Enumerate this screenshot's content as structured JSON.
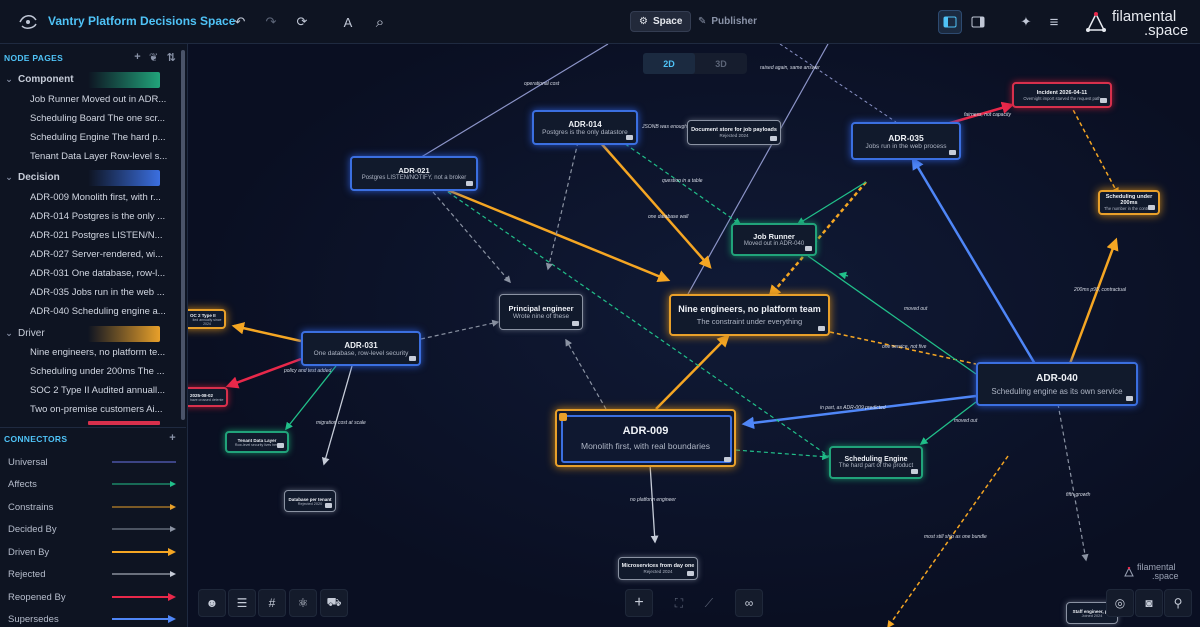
{
  "app": {
    "title": "Vantry Platform Decisions Space"
  },
  "toolbar": {
    "undo": "↶",
    "redo": "↷",
    "refresh": "⟳",
    "font": "A",
    "search": "⌕",
    "tabs": [
      {
        "label": "Space",
        "icon": "cube-icon"
      },
      {
        "label": "Publisher",
        "icon": "feather-icon"
      }
    ],
    "sparkle": "✦",
    "menu": "≡"
  },
  "brand": {
    "line1": "filamental",
    "line2": ".space"
  },
  "sidebar": {
    "node_pages_title": "NODE PAGES",
    "groups": [
      {
        "label": "Component",
        "color": "#21a37a",
        "items": [
          "Job Runner Moved out in ADR...",
          "Scheduling Board The one scr...",
          "Scheduling Engine The hard p...",
          "Tenant Data Layer Row-level s..."
        ]
      },
      {
        "label": "Decision",
        "color": "#3b6fe0",
        "items": [
          "ADR-009 Monolith first, with r...",
          "ADR-014 Postgres is the only ...",
          "ADR-021 Postgres LISTEN/N...",
          "ADR-027 Server-rendered, wi...",
          "ADR-031 One database, row-l...",
          "ADR-035 Jobs run in the web ...",
          "ADR-040 Scheduling engine a..."
        ]
      },
      {
        "label": "Driver",
        "color": "#e8a02a",
        "items": [
          "Nine engineers, no platform te...",
          "Scheduling under 200ms The ...",
          "SOC 2 Type II Audited annuall...",
          "Two on-premise customers Ai..."
        ]
      }
    ],
    "connectors_title": "CONNECTORS",
    "connectors": [
      {
        "label": "Universal",
        "color": "#6a74e8",
        "arrow": false
      },
      {
        "label": "Affects",
        "color": "#21c08a",
        "arrow": true
      },
      {
        "label": "Constrains",
        "color": "#e8a02a",
        "arrow": true
      },
      {
        "label": "Decided By",
        "color": "#8b93a3",
        "arrow": true
      },
      {
        "label": "Driven By",
        "color": "#f5a623",
        "arrow": true
      },
      {
        "label": "Rejected",
        "color": "#c6ccd8",
        "arrow": true
      },
      {
        "label": "Reopened By",
        "color": "#e8284a",
        "arrow": true
      },
      {
        "label": "Supersedes",
        "color": "#4f86f7",
        "arrow": true
      }
    ]
  },
  "canvas": {
    "view_2d": "2D",
    "view_3d": "3D",
    "nodes": {
      "adr014": {
        "title": "ADR-014",
        "sub": "Postgres is the only datastore"
      },
      "docstore": {
        "title": "Document store for job payloads",
        "sub": "Rejected 2024"
      },
      "adr035": {
        "title": "ADR-035",
        "sub": "Jobs run in the web process"
      },
      "incident": {
        "title": "Incident 2026-04-11",
        "sub": "Overnight import starved the request path"
      },
      "sched200": {
        "title": "Scheduling under 200ms",
        "sub": "The number in the contract"
      },
      "adr021": {
        "title": "ADR-021",
        "sub": "Postgres LISTEN/NOTIFY, not a broker"
      },
      "jobrunner": {
        "title": "Job Runner",
        "sub": "Moved out in ADR-040"
      },
      "principal": {
        "title": "Principal engineer",
        "sub": "Wrote nine of these"
      },
      "nine": {
        "title": "Nine engineers, no platform team",
        "sub": "The constraint under everything"
      },
      "soc2": {
        "title": "OC 2 Type II",
        "sub": "ited annually since 2024"
      },
      "adr031": {
        "title": "ADR-031",
        "sub": "One database, row-level security"
      },
      "adr040": {
        "title": "ADR-040",
        "sub": "Scheduling engine as its own service"
      },
      "twoonprem": {
        "title": "2025-08-02",
        "sub": "have crossed detente"
      },
      "tenant": {
        "title": "Tenant Data Layer",
        "sub": "Row-level security lives here"
      },
      "adr009": {
        "title": "ADR-009",
        "sub": "Monolith first, with real boundaries"
      },
      "schedeng": {
        "title": "Scheduling Engine",
        "sub": "The hard part of the product"
      },
      "dbtenant": {
        "title": "Database per tenant",
        "sub": "Rejected 2020"
      },
      "micro": {
        "title": "Microservices from day one",
        "sub": "Rejected 2024"
      },
      "staff": {
        "title": "Staff engineer, pla",
        "sub": "Joined 2024"
      }
    },
    "edge_labels": {
      "e1": "operational cost",
      "e2": "raised again, same answer",
      "e3": "JSONB was enough",
      "e4": "fairness, not capacity",
      "e5": "question in a table",
      "e6": "one database wall",
      "e7": "200ms p95, contractual",
      "e8": "moved out",
      "e9": "one service, not five",
      "e10": "policy and test added",
      "e11": "migration cost at scale",
      "e12": "in part, as ADR-009 predicted",
      "e13": "moved out",
      "e14": "no platform engineer",
      "e15": "most still ship as one bundle",
      "e16": "fifth growth"
    },
    "watermark": {
      "line1": "filamental",
      "line2": ".space"
    }
  }
}
